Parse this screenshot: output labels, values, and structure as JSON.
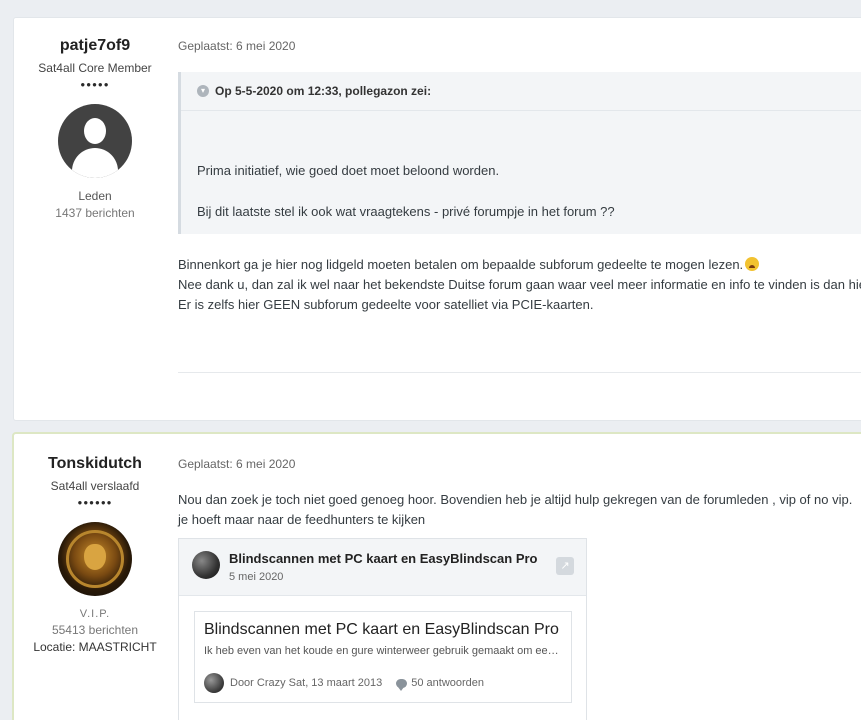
{
  "posts": [
    {
      "author": {
        "username": "patje7of9",
        "rank_title": "Sat4all Core Member",
        "rank_pips": "●●●●●",
        "group": "Leden",
        "post_count": "1437 berichten"
      },
      "posted": "Geplaatst: 6 mei 2020",
      "quote": {
        "header": "Op 5-5-2020 om 12:33, pollegazon zei:",
        "lines": [
          "Prima initiatief, wie goed doet moet beloond worden.",
          "Bij dit laatste stel ik ook wat vraagtekens - privé forumpje in het forum ??"
        ]
      },
      "body": [
        "Binnenkort ga je hier nog lidgeld moeten betalen om bepaalde subforum gedeelte te mogen lezen.",
        "Nee dank u, dan zal ik wel naar het bekendste Duitse forum gaan waar veel meer informatie en info te vinden is dan hier.",
        "Er is zelfs hier GEEN subforum gedeelte voor satelliet via PCIE-kaarten."
      ]
    },
    {
      "author": {
        "username": "Tonskidutch",
        "rank_title": "Sat4all verslaafd",
        "rank_pips": "●●●●●●",
        "group": "V.I.P.",
        "post_count": "55413 berichten",
        "location": "Locatie: MAASTRICHT"
      },
      "posted": "Geplaatst: 6 mei 2020",
      "body": [
        "Nou dan zoek je toch niet goed genoeg hoor. Bovendien heb je altijd hulp gekregen van de forumleden , vip of no vip.",
        "je hoeft maar naar de feedhunters te kijken"
      ],
      "embed": {
        "title": "Blindscannen met PC kaart en EasyBlindscan Pro",
        "date": "5 mei 2020",
        "topic": {
          "title": "Blindscannen met PC kaart en EasyBlindscan Pro",
          "snippet": "Ik heb even van het koude en gure winterweer gebruik gemaakt om een beetje te blindscannen met de PC kaart",
          "meta": "Door Crazy Sat, 13 maart 2013",
          "replies": "50 antwoorden"
        }
      }
    }
  ],
  "colors": {
    "accent_border": "#dde7c4",
    "page_bg": "#ebeef2"
  }
}
